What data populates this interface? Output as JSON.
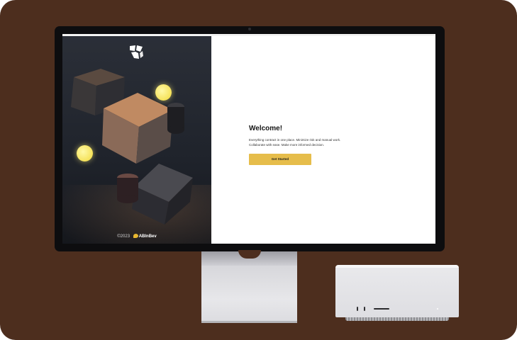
{
  "screen": {
    "hero": {
      "logo_icon": "company-logo-icon",
      "footer": {
        "copyright": "©2023",
        "brand_icon": "abinbev-logo-icon",
        "brand": "ABInBev"
      }
    },
    "welcome": {
      "title": "Welcome!",
      "description_line1": "Everything contract in one place. Minimize risk and manual work.",
      "description_line2": "Collaborate with ease. Make more informed decision.",
      "cta_label": "Get Started"
    }
  },
  "colors": {
    "background": "#4d2e1e",
    "accent": "#e6bd4b",
    "hero_panel": "#1f232b",
    "sphere": "#f5e25a"
  }
}
